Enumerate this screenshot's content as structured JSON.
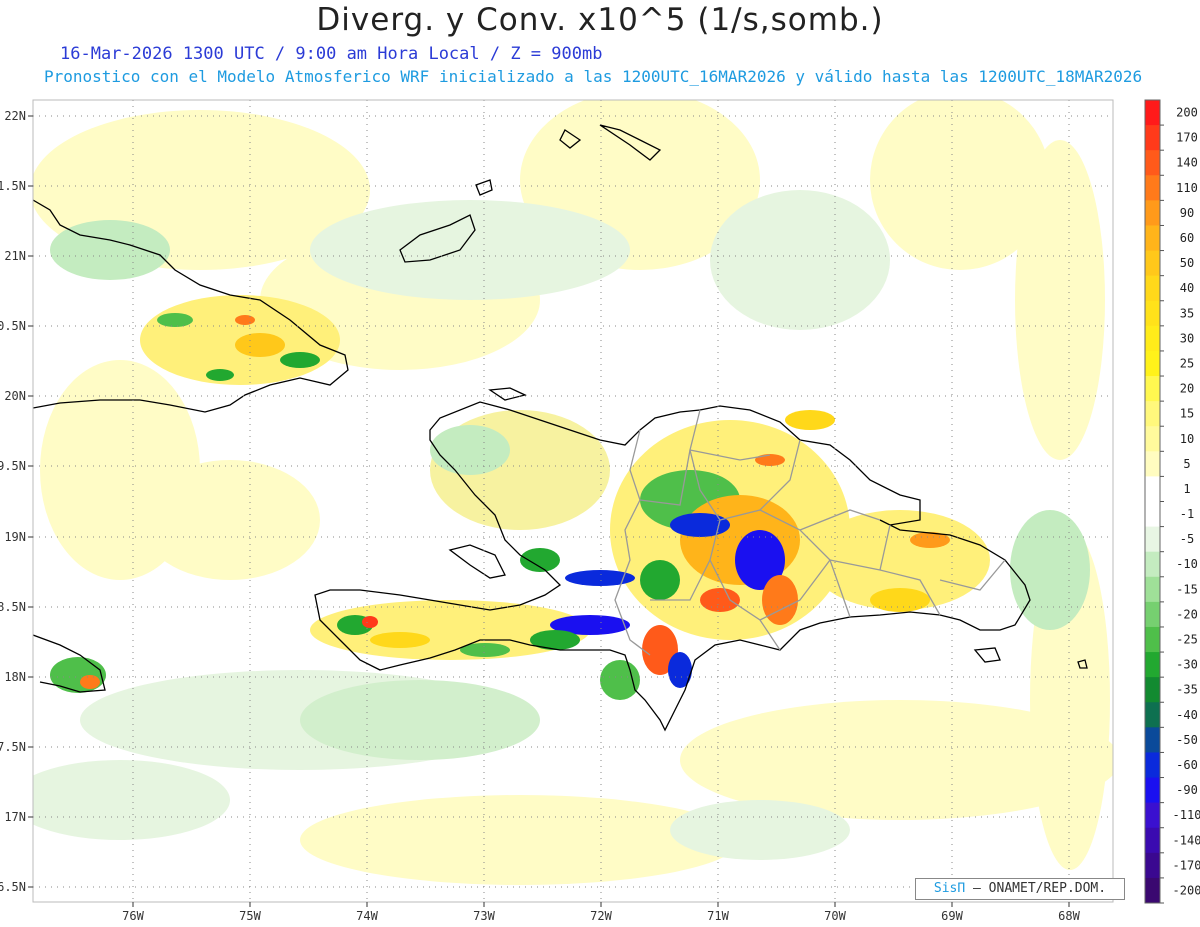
{
  "header": {
    "title": "Diverg. y Conv. x10^5 (1/s,somb.)",
    "line1": "16-Mar-2026  1300 UTC / 9:00 am Hora Local / Z = 900mb",
    "line2": "Pronostico con el Modelo Atmosferico WRF inicializado a las 1200UTC_16MAR2026 y válido hasta las  1200UTC_18MAR2026"
  },
  "axes": {
    "lat_labels": [
      "22N",
      "1.5N",
      "21N",
      "0.5N",
      "20N",
      "9.5N",
      "19N",
      "8.5N",
      "18N",
      "7.5N",
      "17N",
      "6.5N"
    ],
    "lon_labels": [
      "76W",
      "75W",
      "74W",
      "73W",
      "72W",
      "71W",
      "70W",
      "69W",
      "68W"
    ]
  },
  "colorbar": {
    "labels": [
      "200",
      "170",
      "140",
      "110",
      "90",
      "60",
      "50",
      "40",
      "35",
      "30",
      "25",
      "20",
      "15",
      "10",
      "5",
      "1",
      "-1",
      "-5",
      "-10",
      "-15",
      "-20",
      "-25",
      "-30",
      "-35",
      "-40",
      "-50",
      "-60",
      "-90",
      "-110",
      "-140",
      "-170",
      "-200"
    ],
    "colors": [
      "#ff1a1a",
      "#ff3a1a",
      "#ff5a1a",
      "#ff7a1a",
      "#ff9a1a",
      "#ffb41a",
      "#ffc81a",
      "#ffd81a",
      "#ffe21a",
      "#ffec1a",
      "#fff21a",
      "#fff850",
      "#fff87c",
      "#fffa9c",
      "#fffcc0",
      "#ffffff",
      "#ffffff",
      "#e8f6e4",
      "#c4ecc0",
      "#9fe098",
      "#76d070",
      "#4fbf4a",
      "#22a830",
      "#128a30",
      "#0e7050",
      "#0a4a9a",
      "#0a2adc",
      "#1a10f0",
      "#3a10d0",
      "#3a0ab0",
      "#3a0890",
      "#3a0870"
    ]
  },
  "credit": {
    "logo": "SisΠ",
    "text": "– ONAMET/REP.DOM."
  },
  "colors": {
    "coast": "#000000",
    "provinces": "#999999",
    "grid": "#888888"
  }
}
